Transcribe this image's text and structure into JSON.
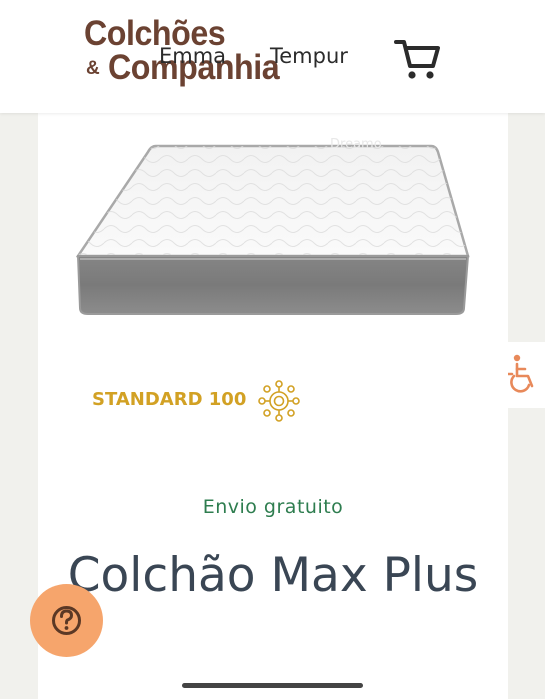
{
  "header": {
    "logo": {
      "line1": "Colchões",
      "ampersand": "&",
      "line2": "Companhia"
    },
    "nav": [
      {
        "label": "Emma"
      },
      {
        "label": "Tempur"
      }
    ],
    "cart_icon": "shopping-cart-icon"
  },
  "product": {
    "image_icon": "mattress-image",
    "watermark": "Dreamo",
    "certification": {
      "label": "STANDARD 100",
      "icon": "oeko-tex-sun-icon"
    },
    "shipping": "Envio gratuito",
    "title": "Colchão Max Plus"
  },
  "widgets": {
    "accessibility_icon": "wheelchair-accessibility-icon",
    "help_icon": "question-help-icon"
  },
  "colors": {
    "brand_brown": "#6b4232",
    "shipping_green": "#2e7d4f",
    "title_slate": "#3a4654",
    "certification_gold": "#d2a124",
    "help_orange": "#f6a56c",
    "accessibility_orange": "#e8895a"
  }
}
